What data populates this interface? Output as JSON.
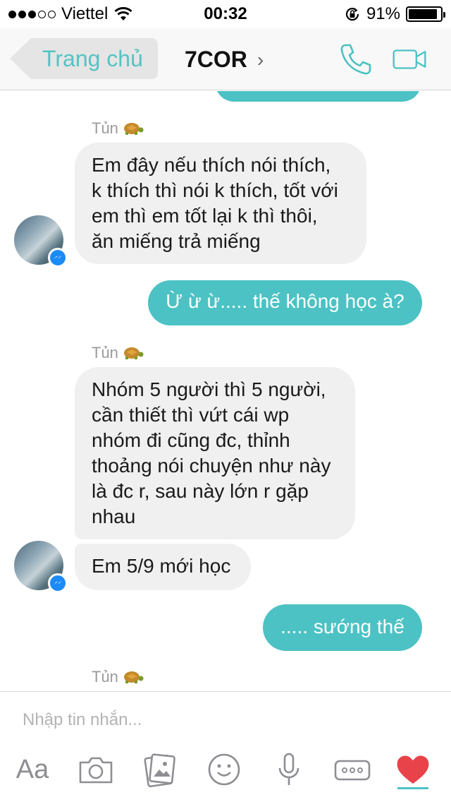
{
  "status_bar": {
    "carrier": "Viettel",
    "time": "00:32",
    "battery_percent": "91%",
    "battery_level": 0.91
  },
  "nav": {
    "back_label": "Trang chủ",
    "title": "7COR",
    "title_chevron": "›",
    "accent_color": "#55c3c3"
  },
  "messages": [
    {
      "side": "in",
      "sender": "Tủn",
      "lines": [
        "Em đây nếu thích nói thích,",
        "k thích thì nói k thích, tốt với",
        "em thì em tốt lại k thì thôi,",
        "ăn miếng trả miếng"
      ]
    },
    {
      "side": "out",
      "text": "Ừ ừ ừ..... thế không học à?"
    },
    {
      "side": "in",
      "sender": "Tủn",
      "lines": [
        "Nhóm 5 người thì 5 người,",
        "cần thiết thì vứt cái wp",
        "nhóm đi cũng đc, thỉnh",
        "thoảng nói chuyện như này",
        "là đc r, sau này lớn r gặp",
        "nhau"
      ]
    },
    {
      "side": "in",
      "text": "Em 5/9 mới học"
    },
    {
      "side": "out",
      "text": "..... sướng thế"
    },
    {
      "side": "in",
      "sender": "Tủn"
    }
  ],
  "compose": {
    "placeholder": "Nhập tin nhắn...",
    "aa_label": "Aa",
    "tools": [
      "aa-icon",
      "camera-icon",
      "gallery-icon",
      "emoji-icon",
      "microphone-icon",
      "more-icon",
      "heart-icon"
    ]
  }
}
